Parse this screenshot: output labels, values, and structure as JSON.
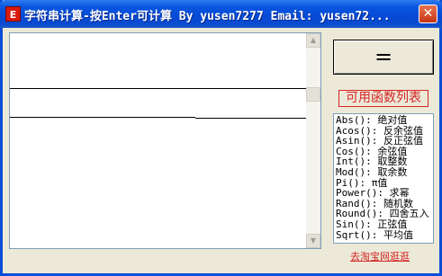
{
  "window": {
    "title": "字符串计算-按Enter可计算  By yusen7277 Email: yusen72...",
    "icon_text": "E",
    "icon": "app-icon",
    "close_symbol": "✕"
  },
  "result_button": {
    "label": "="
  },
  "function_list": {
    "label": "可用函数列表",
    "items": [
      "Abs(): 绝对值",
      "Acos(): 反余弦值",
      "Asin(): 反正弦值",
      "Cos(): 余弦值",
      "Int(): 取整数",
      "Mod(): 取余数",
      "Pi(): π值",
      "Power(): 求幂",
      "Rand(): 随机数",
      "Round(): 四舍五入",
      "Sin(): 正弦值",
      "Sqrt(): 平均值"
    ]
  },
  "link": {
    "label": "去淘宝网逛逛"
  },
  "icons": {
    "scroll_up": "▲",
    "scroll_down": "▼"
  }
}
